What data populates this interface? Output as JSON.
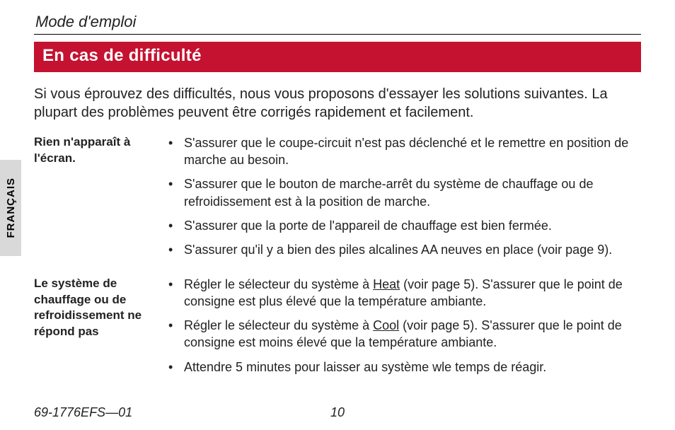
{
  "header": {
    "doc_title": "Mode d'emploi"
  },
  "section": {
    "title": "En cas de difficulté"
  },
  "intro": "Si vous éprouvez des difficultés, nous vous proposons d'essayer les solutions suivantes. La plupart des problèmes peuvent être corrigés rapidement et facilement.",
  "side_tab": "FRANÇAIS",
  "troubles": [
    {
      "problem": "Rien n'apparaît à l'écran.",
      "solutions": [
        "S'assurer que le coupe-circuit n'est pas déclenché et le remettre en position de marche au besoin.",
        "S'assurer que le bouton de marche-arrêt du système de chauffage ou de refroidissement est à la position de marche.",
        "S'assurer que la porte de l'appareil de chauffage est bien fermée.",
        "S'assurer qu'il y a bien des piles alcalines AA neuves en place (voir page 9)."
      ]
    },
    {
      "problem": "Le système de chauffage ou de refroidissement ne répond pas",
      "solutions_rich": [
        {
          "pre": "Régler le sélecteur du système à ",
          "u": "Heat",
          "post": " (voir page 5). S'assurer que le point de consigne est plus élevé que la température ambiante."
        },
        {
          "pre": "Régler le sélecteur du système à ",
          "u": "Cool",
          "post": " (voir page 5). S'assurer que le point de consigne est moins élevé que la température ambiante."
        }
      ],
      "solutions_plain_tail": [
        "Attendre 5 minutes pour laisser au système wle temps de réagir."
      ]
    }
  ],
  "footer": {
    "docnum": "69-1776EFS—01",
    "pagenum": "10"
  }
}
